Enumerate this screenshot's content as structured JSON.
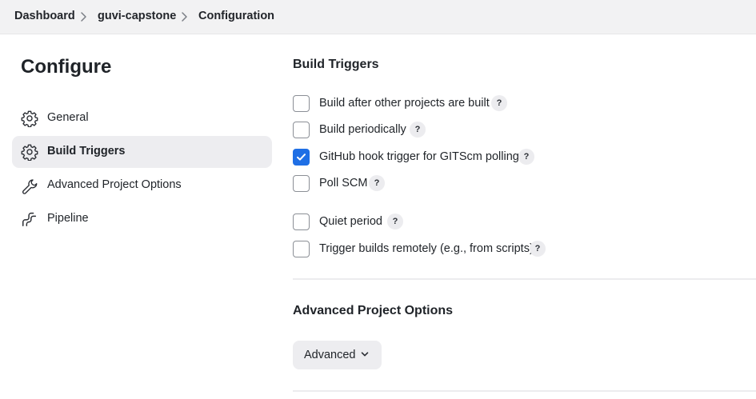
{
  "breadcrumb": {
    "items": [
      "Dashboard",
      "guvi-capstone",
      "Configuration"
    ],
    "separator_icon": "chevron-right-icon"
  },
  "sidebar": {
    "title": "Configure",
    "items": [
      {
        "label": "General",
        "icon": "gear-icon",
        "active": false
      },
      {
        "label": "Build Triggers",
        "icon": "gear-icon",
        "active": true
      },
      {
        "label": "Advanced Project Options",
        "icon": "wrench-icon",
        "active": false
      },
      {
        "label": "Pipeline",
        "icon": "pipeline-icon",
        "active": false
      }
    ]
  },
  "build_triggers": {
    "title": "Build Triggers",
    "help_label": "?",
    "options": [
      {
        "label": "Build after other projects are built",
        "checked": false
      },
      {
        "label": "Build periodically",
        "checked": false
      },
      {
        "label": "GitHub hook trigger for GITScm polling",
        "checked": true
      },
      {
        "label": "Poll SCM",
        "checked": false
      },
      {
        "label": "Quiet period",
        "checked": false
      },
      {
        "label": "Trigger builds remotely (e.g., from scripts)",
        "checked": false
      }
    ]
  },
  "advanced_options": {
    "title": "Advanced Project Options",
    "button_label": "Advanced",
    "button_icon": "chevron-down-icon"
  },
  "colors": {
    "accent": "#1f6fe5",
    "active_bg": "#ededf0",
    "topbar_bg": "#f2f2f3"
  }
}
